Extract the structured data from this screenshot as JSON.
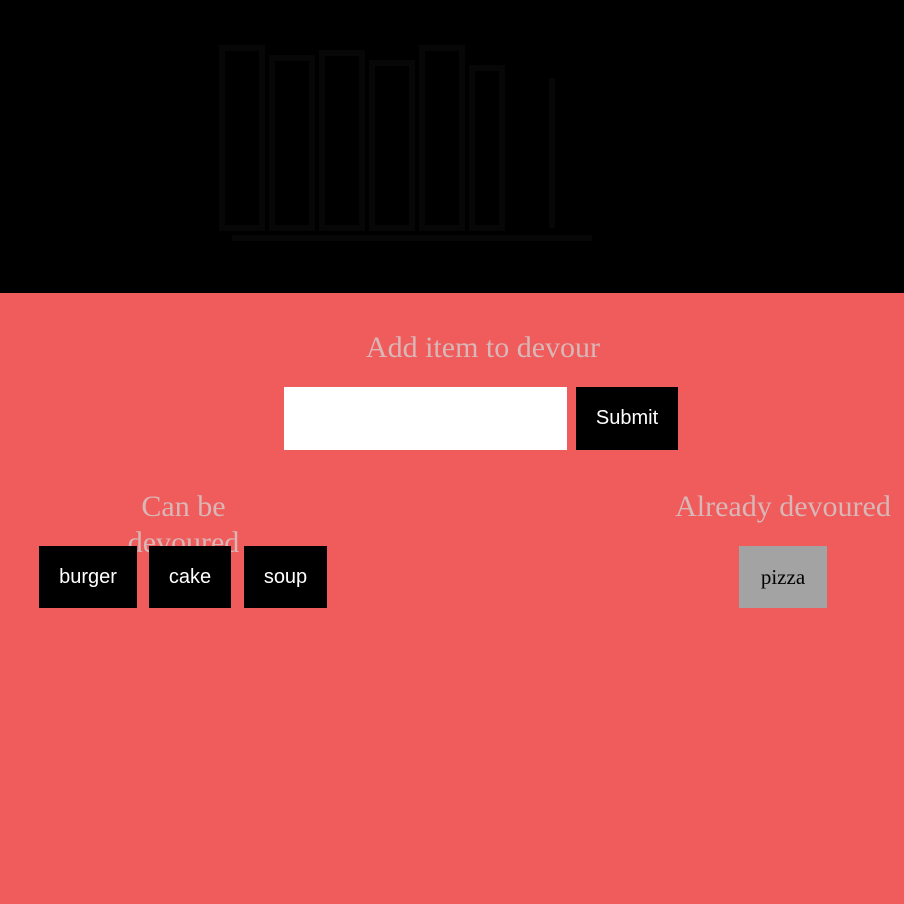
{
  "form": {
    "title": "Add item to devour",
    "input_value": "",
    "input_placeholder": "",
    "submit_label": "Submit"
  },
  "can_be_devoured": {
    "title": "Can be devoured",
    "items": [
      "burger",
      "cake",
      "soup"
    ]
  },
  "already_devoured": {
    "title": "Already devoured",
    "items": [
      "pizza"
    ]
  },
  "colors": {
    "page_background": "#f05b5b",
    "hero_background": "#000000",
    "heading_text": "#d9b7b7",
    "item_button": "#000000",
    "devoured_item": "#a3a3a3"
  }
}
